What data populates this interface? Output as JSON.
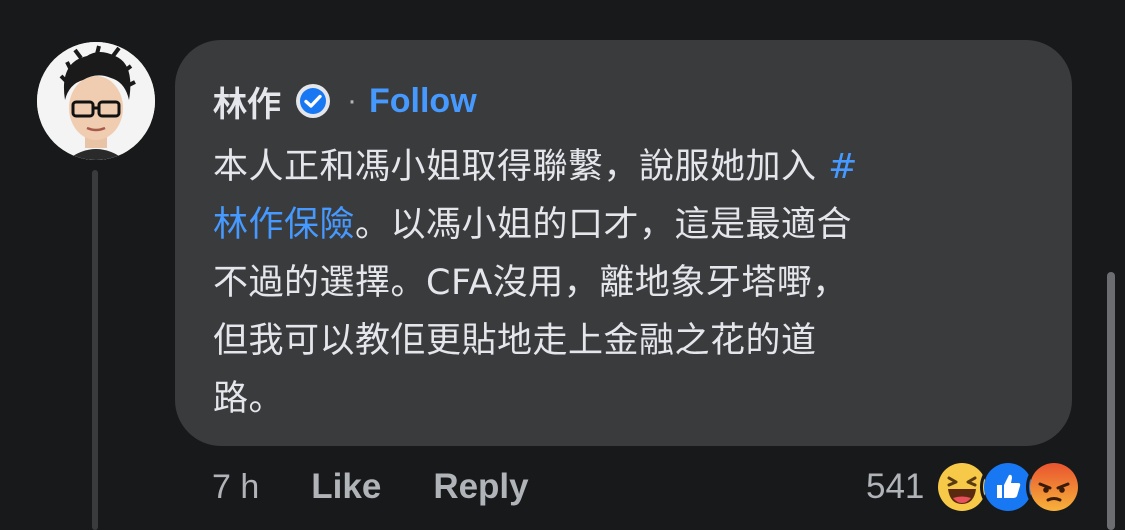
{
  "comment": {
    "author": "林作",
    "separator": "·",
    "follow_label": "Follow",
    "text_lines": [
      {
        "pre": "本人正和馮小姐取得聯繫，說服她加入 ",
        "tag": "#"
      },
      {
        "tag": "林作保險",
        "post": "。以馮小姐的口才，這是最適合"
      },
      {
        "pre": "不過的選擇。CFA沒用，離地象牙塔嘢，"
      },
      {
        "pre": "但我可以教佢更貼地走上金融之花的道"
      },
      {
        "pre": "路。"
      }
    ]
  },
  "actions": {
    "time": "7 h",
    "like_label": "Like",
    "reply_label": "Reply"
  },
  "reactions": {
    "count": "541",
    "icons": [
      "haha-icon",
      "like-icon",
      "angry-icon"
    ]
  },
  "colors": {
    "background": "#18191a",
    "bubble": "#3a3b3c",
    "accent": "#4599ff",
    "secondary_text": "#b0b3b8"
  }
}
